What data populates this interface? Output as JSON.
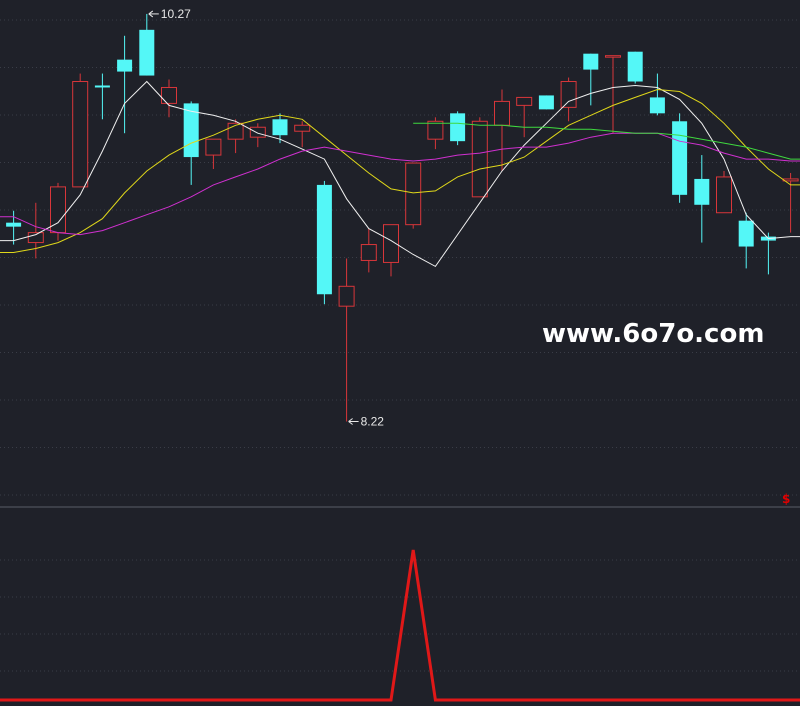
{
  "chart_data": [
    {
      "type": "candlestick",
      "ylim": [
        7.8,
        10.34
      ],
      "x_count": 36,
      "up_color": "#d8363a",
      "down_color": "#54f7f7",
      "candles": [
        {
          "o": 9.22,
          "h": 9.28,
          "l": 9.11,
          "c": 9.2
        },
        {
          "o": 9.12,
          "h": 9.32,
          "l": 9.04,
          "c": 9.17
        },
        {
          "o": 9.17,
          "h": 9.42,
          "l": 9.13,
          "c": 9.4
        },
        {
          "o": 9.4,
          "h": 9.97,
          "l": 9.4,
          "c": 9.93
        },
        {
          "o": 9.91,
          "h": 9.97,
          "l": 9.74,
          "c": 9.9
        },
        {
          "o": 10.04,
          "h": 10.16,
          "l": 9.67,
          "c": 9.98
        },
        {
          "o": 10.19,
          "h": 10.27,
          "l": 9.98,
          "c": 9.96
        },
        {
          "o": 9.82,
          "h": 9.94,
          "l": 9.75,
          "c": 9.9
        },
        {
          "o": 9.82,
          "h": 9.83,
          "l": 9.41,
          "c": 9.55
        },
        {
          "o": 9.56,
          "h": 9.64,
          "l": 9.49,
          "c": 9.64
        },
        {
          "o": 9.64,
          "h": 9.74,
          "l": 9.57,
          "c": 9.72
        },
        {
          "o": 9.65,
          "h": 9.72,
          "l": 9.6,
          "c": 9.7
        },
        {
          "o": 9.74,
          "h": 9.77,
          "l": 9.62,
          "c": 9.66
        },
        {
          "o": 9.68,
          "h": 9.73,
          "l": 9.6,
          "c": 9.71
        },
        {
          "o": 9.41,
          "h": 9.43,
          "l": 8.81,
          "c": 8.86
        },
        {
          "o": 8.8,
          "h": 9.04,
          "l": 8.22,
          "c": 8.9
        },
        {
          "o": 9.03,
          "h": 9.19,
          "l": 8.97,
          "c": 9.11
        },
        {
          "o": 9.02,
          "h": 9.14,
          "l": 8.95,
          "c": 9.21
        },
        {
          "o": 9.21,
          "h": 9.52,
          "l": 9.19,
          "c": 9.52
        },
        {
          "o": 9.64,
          "h": 9.75,
          "l": 9.59,
          "c": 9.73
        },
        {
          "o": 9.77,
          "h": 9.78,
          "l": 9.61,
          "c": 9.63
        },
        {
          "o": 9.35,
          "h": 9.75,
          "l": 9.38,
          "c": 9.73
        },
        {
          "o": 9.71,
          "h": 9.89,
          "l": 9.48,
          "c": 9.83
        },
        {
          "o": 9.81,
          "h": 9.84,
          "l": 9.65,
          "c": 9.85
        },
        {
          "o": 9.86,
          "h": 9.84,
          "l": 9.8,
          "c": 9.79
        },
        {
          "o": 9.8,
          "h": 9.95,
          "l": 9.73,
          "c": 9.93
        },
        {
          "o": 10.07,
          "h": 10.07,
          "l": 9.81,
          "c": 9.99
        },
        {
          "o": 10.06,
          "h": 10.03,
          "l": 9.67,
          "c": 10.06
        },
        {
          "o": 10.08,
          "h": 10.07,
          "l": 9.92,
          "c": 9.93
        },
        {
          "o": 9.85,
          "h": 9.97,
          "l": 9.76,
          "c": 9.77
        },
        {
          "o": 9.73,
          "h": 9.77,
          "l": 9.32,
          "c": 9.36
        },
        {
          "o": 9.44,
          "h": 9.56,
          "l": 9.12,
          "c": 9.31
        },
        {
          "o": 9.27,
          "h": 9.48,
          "l": 9.27,
          "c": 9.45
        },
        {
          "o": 9.23,
          "h": 9.27,
          "l": 8.99,
          "c": 9.1
        },
        {
          "o": 9.15,
          "h": 9.17,
          "l": 8.96,
          "c": 9.13
        },
        {
          "o": 9.43,
          "h": 9.47,
          "l": 9.17,
          "c": 9.44
        }
      ],
      "ma_lines": [
        {
          "color": "#f0f0f0",
          "values": [
            9.13,
            9.16,
            9.22,
            9.36,
            9.58,
            9.82,
            9.93,
            9.81,
            9.78,
            9.76,
            9.73,
            9.67,
            9.64,
            9.59,
            9.54,
            9.34,
            9.19,
            9.13,
            9.06,
            9.0,
            9.16,
            9.32,
            9.48,
            9.61,
            9.72,
            9.83,
            9.87,
            9.9,
            9.91,
            9.9,
            9.84,
            9.72,
            9.54,
            9.26,
            9.14,
            9.15
          ]
        },
        {
          "color": "#e0d81a",
          "values": [
            9.07,
            9.09,
            9.12,
            9.17,
            9.24,
            9.37,
            9.48,
            9.56,
            9.62,
            9.66,
            9.71,
            9.74,
            9.76,
            9.74,
            9.65,
            9.56,
            9.47,
            9.39,
            9.37,
            9.38,
            9.45,
            9.49,
            9.51,
            9.55,
            9.63,
            9.71,
            9.76,
            9.81,
            9.85,
            9.89,
            9.88,
            9.82,
            9.72,
            9.6,
            9.49,
            9.41
          ]
        },
        {
          "color": "#d030d0",
          "values": [
            9.25,
            9.2,
            9.17,
            9.16,
            9.18,
            9.22,
            9.26,
            9.3,
            9.35,
            9.41,
            9.45,
            9.49,
            9.54,
            9.58,
            9.6,
            9.58,
            9.56,
            9.54,
            9.53,
            9.54,
            9.56,
            9.57,
            9.59,
            9.6,
            9.6,
            9.62,
            9.65,
            9.67,
            9.67,
            9.67,
            9.63,
            9.61,
            9.57,
            9.54,
            9.54,
            9.53
          ]
        },
        {
          "color": "#3fd93f",
          "startIndex": 18,
          "values": [
            9.72,
            9.72,
            9.72,
            9.71,
            9.71,
            9.7,
            9.7,
            9.69,
            9.69,
            9.68,
            9.67,
            9.67,
            9.66,
            9.64,
            9.62,
            9.6,
            9.57,
            9.54
          ]
        }
      ],
      "annotations": [
        {
          "label": "10.27",
          "index": 6,
          "value": 10.27,
          "position": "above"
        },
        {
          "label": "8.22",
          "index": 15,
          "value": 8.22,
          "position": "below"
        }
      ],
      "watermark": "www.6o7o.com",
      "signal_marker": "$"
    },
    {
      "type": "line",
      "ylim": [
        0,
        1.2
      ],
      "color": "#e01818",
      "values": [
        0,
        0,
        0,
        0,
        0,
        0,
        0,
        0,
        0,
        0,
        0,
        0,
        0,
        0,
        0,
        0,
        0,
        0,
        1,
        0,
        0,
        0,
        0,
        0,
        0,
        0,
        0,
        0,
        0,
        0,
        0,
        0,
        0,
        0,
        0,
        0
      ]
    }
  ]
}
